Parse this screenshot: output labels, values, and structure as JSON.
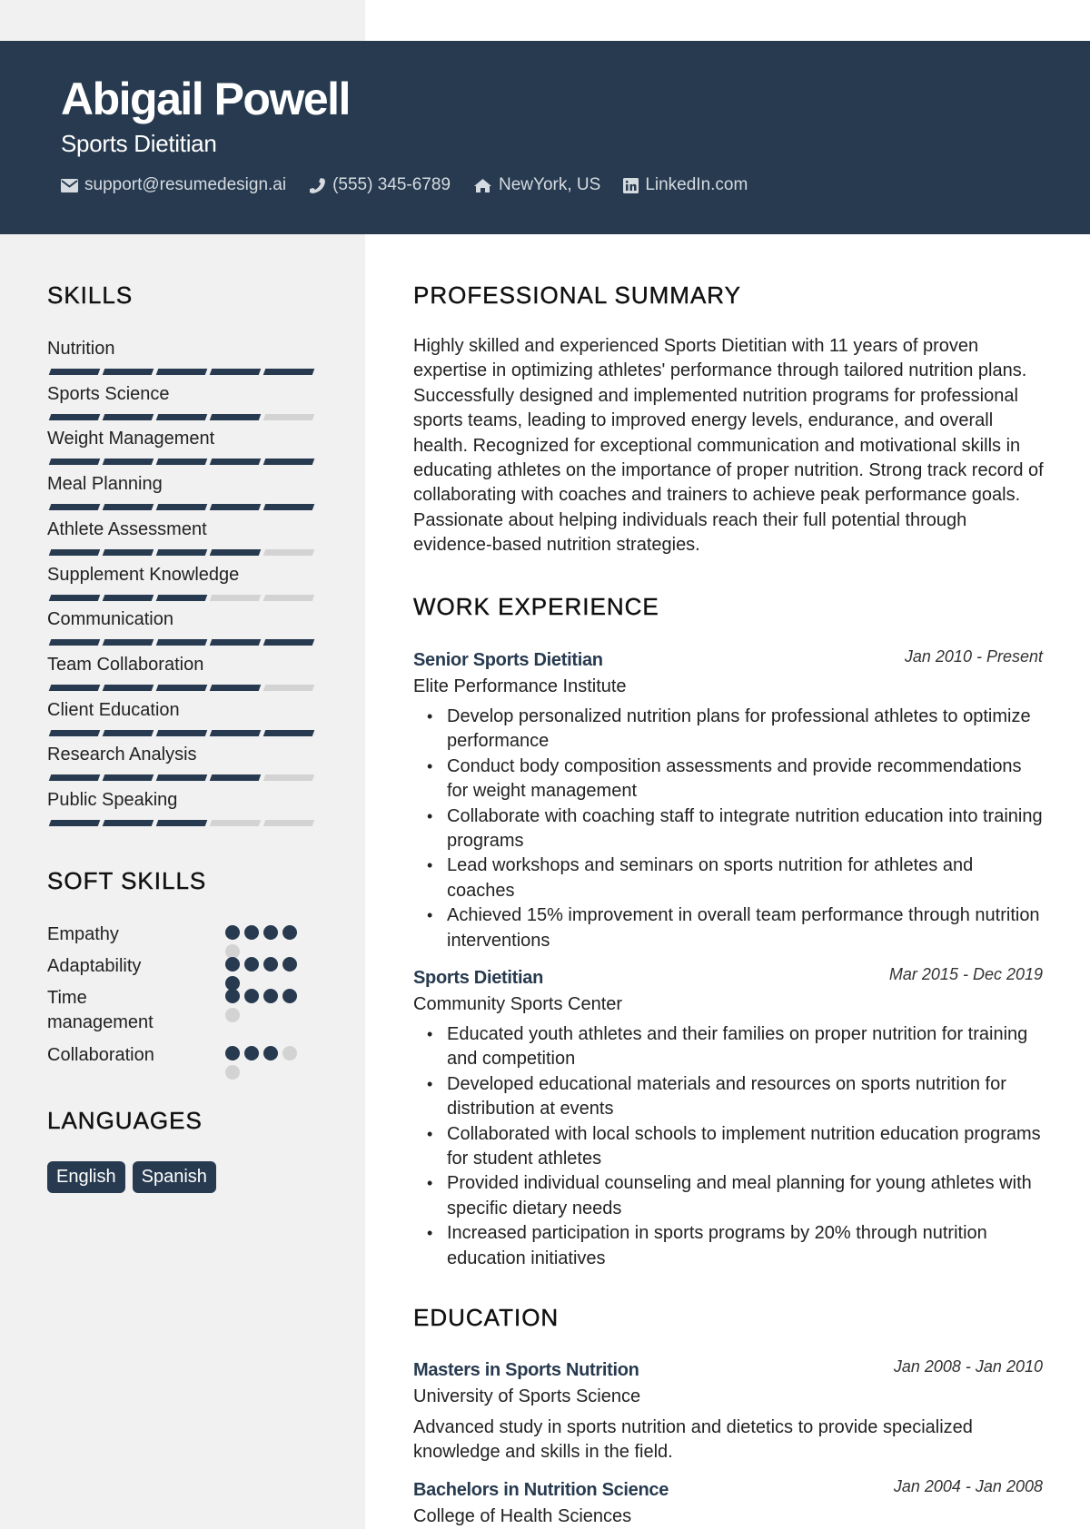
{
  "header": {
    "name": "Abigail Powell",
    "role": "Sports Dietitian",
    "contacts": [
      {
        "icon": "envelope-icon",
        "text": "support@resumedesign.ai"
      },
      {
        "icon": "phone-icon",
        "text": "(555) 345-6789"
      },
      {
        "icon": "home-icon",
        "text": "NewYork, US"
      },
      {
        "icon": "linkedin-icon",
        "text": "LinkedIn.com"
      }
    ]
  },
  "colors": {
    "accent": "#273a4f",
    "sidebar_bg": "#f1f1f1",
    "inactive": "#d3d3d3"
  },
  "skills": {
    "title": "SKILLS",
    "max": 5,
    "items": [
      {
        "label": "Nutrition",
        "level": 5
      },
      {
        "label": "Sports Science",
        "level": 4
      },
      {
        "label": "Weight Management",
        "level": 5
      },
      {
        "label": "Meal Planning",
        "level": 5
      },
      {
        "label": "Athlete Assessment",
        "level": 4
      },
      {
        "label": "Supplement Knowledge",
        "level": 3
      },
      {
        "label": "Communication",
        "level": 5
      },
      {
        "label": "Team Collaboration",
        "level": 4
      },
      {
        "label": "Client Education",
        "level": 5
      },
      {
        "label": "Research Analysis",
        "level": 4
      },
      {
        "label": "Public Speaking",
        "level": 3
      }
    ]
  },
  "soft_skills": {
    "title": "SOFT SKILLS",
    "max": 5,
    "items": [
      {
        "label": "Empathy",
        "level": 4
      },
      {
        "label": "Adaptability",
        "level": 5
      },
      {
        "label": "Time management",
        "level": 4
      },
      {
        "label": "Collaboration",
        "level": 3
      }
    ]
  },
  "languages": {
    "title": "LANGUAGES",
    "items": [
      "English",
      "Spanish"
    ]
  },
  "summary": {
    "title": "PROFESSIONAL SUMMARY",
    "text": "Highly skilled and experienced Sports Dietitian with 11 years of proven expertise in optimizing athletes' performance through tailored nutrition plans. Successfully designed and implemented nutrition programs for professional sports teams, leading to improved energy levels, endurance, and overall health. Recognized for exceptional communication and motivational skills in educating athletes on the importance of proper nutrition. Strong track record of collaborating with coaches and trainers to achieve peak performance goals. Passionate about helping individuals reach their full potential through evidence-based nutrition strategies."
  },
  "experience": {
    "title": "WORK EXPERIENCE",
    "jobs": [
      {
        "title": "Senior Sports Dietitian",
        "date": "Jan 2010 - Present",
        "org": "Elite Performance Institute",
        "bullets": [
          "Develop personalized nutrition plans for professional athletes to optimize performance",
          "Conduct body composition assessments and provide recommendations for weight management",
          "Collaborate with coaching staff to integrate nutrition education into training programs",
          "Lead workshops and seminars on sports nutrition for athletes and coaches",
          "Achieved 15% improvement in overall team performance through nutrition interventions"
        ]
      },
      {
        "title": "Sports Dietitian",
        "date": "Mar 2015 - Dec 2019",
        "org": "Community Sports Center",
        "bullets": [
          "Educated youth athletes and their families on proper nutrition for training and competition",
          "Developed educational materials and resources on sports nutrition for distribution at events",
          "Collaborated with local schools to implement nutrition education programs for student athletes",
          "Provided individual counseling and meal planning for young athletes with specific dietary needs",
          "Increased participation in sports programs by 20% through nutrition education initiatives"
        ]
      }
    ]
  },
  "education": {
    "title": "EDUCATION",
    "items": [
      {
        "degree": "Masters in Sports Nutrition",
        "date": "Jan 2008 - Jan 2010",
        "school": "University of Sports Science",
        "desc": "Advanced study in sports nutrition and dietetics to provide specialized knowledge and skills in the field."
      },
      {
        "degree": "Bachelors in Nutrition Science",
        "date": "Jan 2004 - Jan 2008",
        "school": "College of Health Sciences"
      }
    ]
  }
}
